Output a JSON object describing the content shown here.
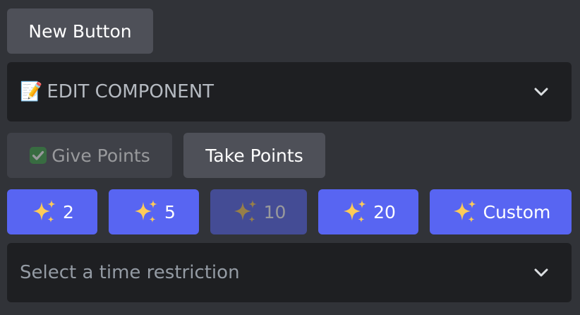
{
  "new_button": {
    "label": "New Button"
  },
  "edit_component": {
    "emoji": "📝",
    "label": "EDIT COMPONENT"
  },
  "action_buttons": [
    {
      "emoji": "✅",
      "label": "Give Points",
      "disabled": true
    },
    {
      "label": "Take Points",
      "disabled": false
    }
  ],
  "point_buttons": [
    {
      "emoji": "✨",
      "label": "2",
      "disabled": false
    },
    {
      "emoji": "✨",
      "label": "5",
      "disabled": false
    },
    {
      "emoji": "✨",
      "label": "10",
      "disabled": true
    },
    {
      "emoji": "✨",
      "label": "20",
      "disabled": false
    },
    {
      "emoji": "✨",
      "label": "Custom",
      "disabled": false
    }
  ],
  "time_restriction": {
    "placeholder": "Select a time restriction"
  },
  "colors": {
    "background": "#313338",
    "secondary_button": "#4e5058",
    "primary_button": "#5865f2",
    "select_background": "#1e1f22"
  }
}
